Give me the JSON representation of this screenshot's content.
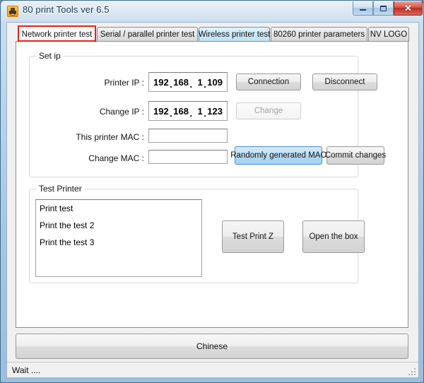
{
  "window": {
    "title": "80 print Tools ver 6.5",
    "icon": "printer-icon",
    "caption_buttons": {
      "minimize": "minimize-icon",
      "maximize": "maximize-icon",
      "close": "✕"
    }
  },
  "tabs": [
    {
      "label": "Network printer test",
      "state": "selected",
      "highlighted": true
    },
    {
      "label": "Serial / parallel printer test",
      "state": "normal",
      "highlighted": false
    },
    {
      "label": "Wireless printer test",
      "state": "hot",
      "highlighted": false
    },
    {
      "label": "80260 printer parameters",
      "state": "normal",
      "highlighted": false
    },
    {
      "label": "NV LOGO",
      "state": "normal",
      "highlighted": false
    }
  ],
  "set_ip_group": {
    "title": "Set ip",
    "printer_ip": {
      "label": "Printer IP :",
      "octets": [
        "192",
        "168",
        "1",
        "109"
      ],
      "separator": "."
    },
    "change_ip": {
      "label": "Change IP :",
      "octets": [
        "192",
        "168",
        "1",
        "123"
      ],
      "separator": "."
    },
    "this_printer_mac": {
      "label": "This printer MAC :",
      "value": "",
      "placeholder": ""
    },
    "change_mac": {
      "label": "Change MAC :",
      "value": "",
      "placeholder": ""
    },
    "buttons": {
      "connection": "Connection",
      "disconnect": "Disconnect",
      "change": "Change",
      "random_mac": "Randomly generated MAC",
      "commit": "Commit changes"
    }
  },
  "test_printer_group": {
    "title": "Test Printer",
    "list_items": [
      "Print test",
      "Print the test 2",
      "Print the test 3"
    ],
    "buttons": {
      "test_print_z": "Test Print Z",
      "open_the_box": "Open the box"
    }
  },
  "language_button": {
    "label": "Chinese"
  },
  "statusbar": {
    "text": "Wait ....",
    "grip": "resize-grip-icon"
  },
  "colors": {
    "accent_highlight": "#ee1c1c",
    "hot_blue": "#aed7f3",
    "titlebar_text": "#13325b",
    "close_button": "#b62f25",
    "icon_orange": "#f59a12"
  }
}
